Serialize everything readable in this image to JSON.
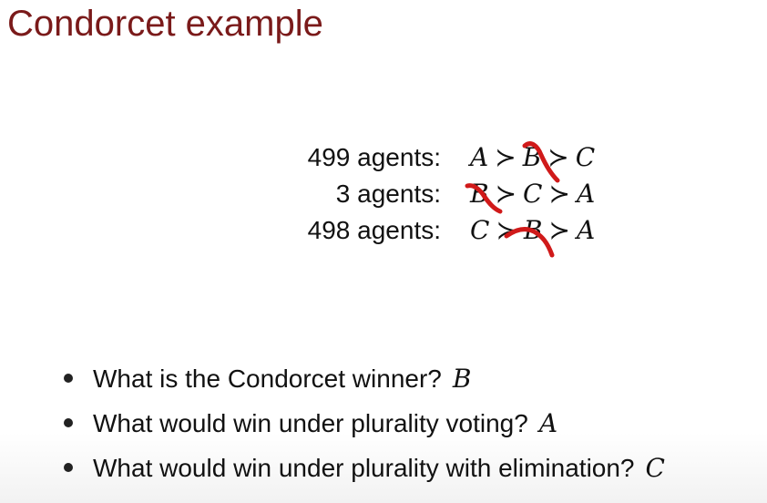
{
  "slide": {
    "title": "Condorcet example"
  },
  "preferences": [
    {
      "agents": "499 agents:",
      "first": "A",
      "second": "B",
      "third": "C"
    },
    {
      "agents": "3 agents:",
      "first": "B",
      "second": "C",
      "third": "A"
    },
    {
      "agents": "498 agents:",
      "first": "C",
      "second": "B",
      "third": "A"
    }
  ],
  "ranking_symbol": "≻",
  "annotation_color": "#d01a1a",
  "questions": [
    {
      "text": "What is the Condorcet winner?",
      "answer": "B"
    },
    {
      "text": "What would win under plurality voting?",
      "answer": "A"
    },
    {
      "text": "What would win under plurality with elimination?",
      "answer": "C"
    }
  ]
}
